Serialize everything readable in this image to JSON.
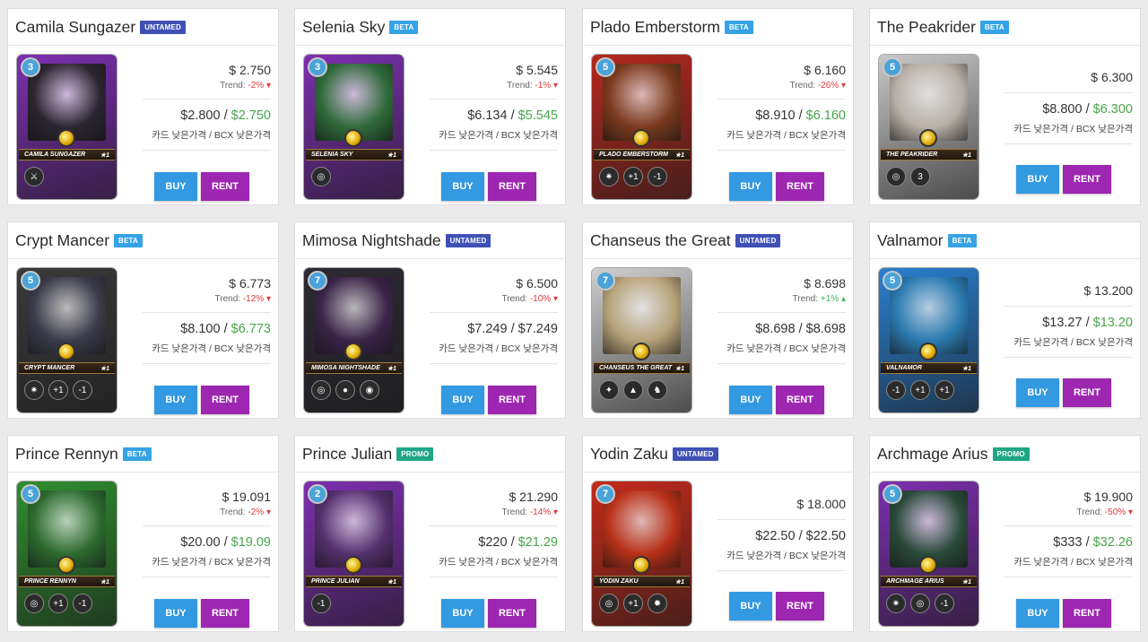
{
  "colors": {
    "untamed": "#3f51b5",
    "beta": "#35a3e6",
    "promo": "#1fa685",
    "buy": "#3399e0",
    "rent": "#9d27b0",
    "trend_down": "#e0383b",
    "trend_up": "#3cb55a",
    "low_price": "#47a54b"
  },
  "labels": {
    "buy": "BUY",
    "rent": "RENT",
    "price_label": "카드 낮은가격 / BCX 낮은가격",
    "trend_prefix": "Trend: "
  },
  "cards": [
    {
      "name": "Camila Sungazer",
      "badge": "UNTAMED",
      "badge_color": "#3f51b5",
      "mana": "3",
      "card_caption": "CAMILA SUNGAZER",
      "level": "★1",
      "price": "$ 2.750",
      "trend": "-2%",
      "trend_dir": "down",
      "card_low": "$2.800",
      "bcx_low": "$2.750",
      "bcx_green": true,
      "frame": "#7d2fb0",
      "art": "#2b2530",
      "abilities": [
        "⚔"
      ]
    },
    {
      "name": "Selenia Sky",
      "badge": "BETA",
      "badge_color": "#35a3e6",
      "mana": "3",
      "card_caption": "SELENIA SKY",
      "level": "★1",
      "price": "$ 5.545",
      "trend": "-1%",
      "trend_dir": "down",
      "card_low": "$6.134",
      "bcx_low": "$5.545",
      "bcx_green": true,
      "frame": "#7d2fb0",
      "art": "#2f6a3a",
      "abilities": [
        "◎"
      ]
    },
    {
      "name": "Plado Emberstorm",
      "badge": "BETA",
      "badge_color": "#35a3e6",
      "mana": "5",
      "card_caption": "PLADO EMBERSTORM",
      "level": "★1",
      "price": "$ 6.160",
      "trend": "-26%",
      "trend_dir": "down",
      "card_low": "$8.910",
      "bcx_low": "$6.160",
      "bcx_green": true,
      "frame": "#b5281f",
      "art": "#7a3a1e",
      "abilities": [
        "✷",
        "+1",
        "-1"
      ]
    },
    {
      "name": "The Peakrider",
      "badge": "BETA",
      "badge_color": "#35a3e6",
      "mana": "5",
      "card_caption": "THE PEAKRIDER",
      "level": "★1",
      "price": "$ 6.300",
      "trend": "",
      "trend_dir": "none",
      "card_low": "$8.800",
      "bcx_low": "$6.300",
      "bcx_green": true,
      "frame": "#c8c8c8",
      "art": "#b8b0a8",
      "abilities": [
        "◎",
        "3"
      ]
    },
    {
      "name": "Crypt Mancer",
      "badge": "BETA",
      "badge_color": "#35a3e6",
      "mana": "5",
      "card_caption": "CRYPT MANCER",
      "level": "★1",
      "price": "$ 6.773",
      "trend": "-12%",
      "trend_dir": "down",
      "card_low": "$8.100",
      "bcx_low": "$6.773",
      "bcx_green": true,
      "frame": "#3a3a3a",
      "art": "#3b3b4a",
      "abilities": [
        "✷",
        "+1",
        "-1"
      ]
    },
    {
      "name": "Mimosa Nightshade",
      "badge": "UNTAMED",
      "badge_color": "#3f51b5",
      "mana": "7",
      "card_caption": "MIMOSA NIGHTSHADE",
      "level": "★1",
      "price": "$ 6.500",
      "trend": "-10%",
      "trend_dir": "down",
      "card_low": "$7.249",
      "bcx_low": "$7.249",
      "bcx_green": false,
      "frame": "#2d2a33",
      "art": "#3a2448",
      "abilities": [
        "◎",
        "●",
        "◉"
      ]
    },
    {
      "name": "Chanseus the Great",
      "badge": "UNTAMED",
      "badge_color": "#3f51b5",
      "mana": "7",
      "card_caption": "CHANSEUS THE GREAT",
      "level": "★1",
      "price": "$ 8.698",
      "trend": "+1%",
      "trend_dir": "up",
      "card_low": "$8.698",
      "bcx_low": "$8.698",
      "bcx_green": false,
      "frame": "#cfcfcf",
      "art": "#b7a37a",
      "abilities": [
        "✦",
        "▲",
        "♞"
      ]
    },
    {
      "name": "Valnamor",
      "badge": "BETA",
      "badge_color": "#35a3e6",
      "mana": "5",
      "card_caption": "VALNAMOR",
      "level": "★1",
      "price": "$ 13.200",
      "trend": "",
      "trend_dir": "none",
      "card_low": "$13.27",
      "bcx_low": "$13.20",
      "bcx_green": true,
      "frame": "#2a7fd0",
      "art": "#2a7ab0",
      "abilities": [
        "-1",
        "+1",
        "+1"
      ]
    },
    {
      "name": "Prince Rennyn",
      "badge": "BETA",
      "badge_color": "#35a3e6",
      "mana": "5",
      "card_caption": "PRINCE RENNYN",
      "level": "★1",
      "price": "$ 19.091",
      "trend": "-2%",
      "trend_dir": "down",
      "card_low": "$20.00",
      "bcx_low": "$19.09",
      "bcx_green": true,
      "frame": "#2f8f2f",
      "art": "#2d6b30",
      "abilities": [
        "◎",
        "+1",
        "-1"
      ]
    },
    {
      "name": "Prince Julian",
      "badge": "PROMO",
      "badge_color": "#1fa685",
      "mana": "2",
      "card_caption": "PRINCE JULIAN",
      "level": "★1",
      "price": "$ 21.290",
      "trend": "-14%",
      "trend_dir": "down",
      "card_low": "$220",
      "bcx_low": "$21.29",
      "bcx_green": true,
      "frame": "#7d2fb0",
      "art": "#55306e",
      "abilities": [
        "-1"
      ]
    },
    {
      "name": "Yodin Zaku",
      "badge": "UNTAMED",
      "badge_color": "#3f51b5",
      "mana": "7",
      "card_caption": "YODIN ZAKU",
      "level": "★1",
      "price": "$ 18.000",
      "trend": "",
      "trend_dir": "none",
      "card_low": "$22.50",
      "bcx_low": "$22.50",
      "bcx_green": false,
      "frame": "#c42a1c",
      "art": "#b83018",
      "abilities": [
        "◎",
        "+1",
        "✹"
      ]
    },
    {
      "name": "Archmage Arius",
      "badge": "PROMO",
      "badge_color": "#1fa685",
      "mana": "5",
      "card_caption": "ARCHMAGE ARIUS",
      "level": "★1",
      "price": "$ 19.900",
      "trend": "-50%",
      "trend_dir": "down",
      "card_low": "$333",
      "bcx_low": "$32.26",
      "bcx_green": true,
      "frame": "#7d2fb0",
      "art": "#2a4a3a",
      "abilities": [
        "✷",
        "◎",
        "-1"
      ]
    }
  ]
}
